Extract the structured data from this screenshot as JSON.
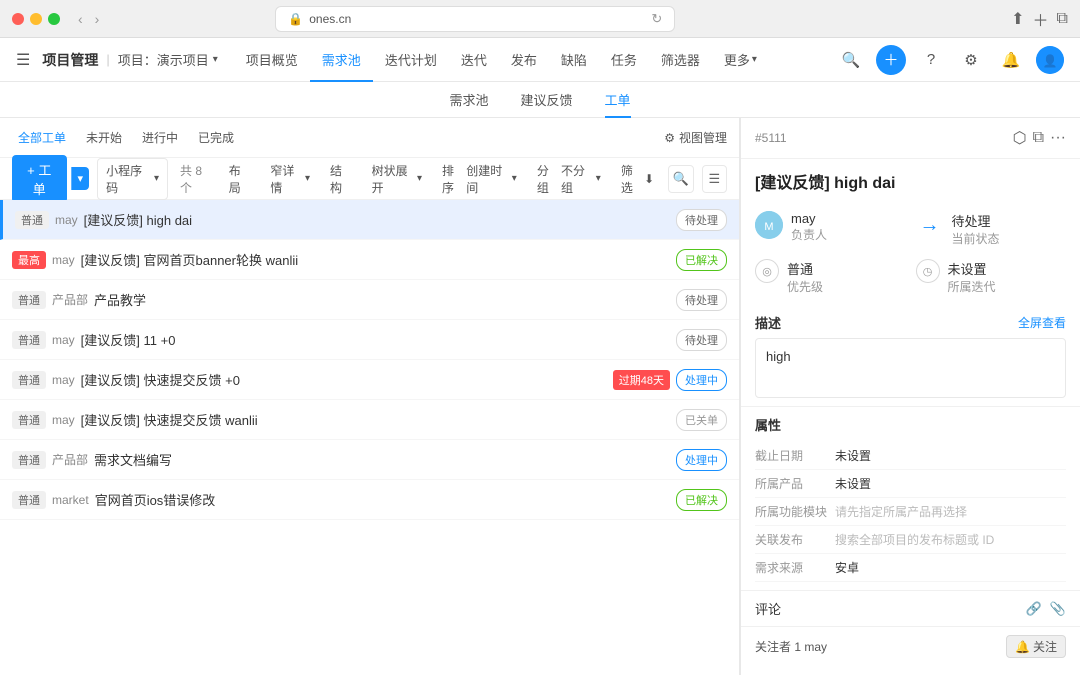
{
  "browser": {
    "url": "ones.cn",
    "lock_icon": "🔒"
  },
  "appbar": {
    "menu_icon": "☰",
    "title": "项目管理",
    "sep": "|",
    "project_label": "项目：演示项目",
    "nav_items": [
      {
        "label": "项目概览",
        "active": false
      },
      {
        "label": "需求池",
        "active": true
      },
      {
        "label": "迭代计划",
        "active": false
      },
      {
        "label": "迭代",
        "active": false
      },
      {
        "label": "发布",
        "active": false
      },
      {
        "label": "缺陷",
        "active": false
      },
      {
        "label": "任务",
        "active": false
      },
      {
        "label": "筛选器",
        "active": false
      },
      {
        "label": "更多",
        "active": false,
        "has_arrow": true
      }
    ]
  },
  "subnav": {
    "items": [
      {
        "label": "需求池",
        "active": false
      },
      {
        "label": "建议反馈",
        "active": false
      },
      {
        "label": "工单",
        "active": true
      }
    ]
  },
  "filter_tabs": [
    {
      "label": "全部工单",
      "active": true
    },
    {
      "label": "未开始",
      "active": false
    },
    {
      "label": "进行中",
      "active": false
    },
    {
      "label": "已完成",
      "active": false
    }
  ],
  "toolbar": {
    "add_label": "+ 工单",
    "filter_label": "小程序码",
    "count_label": "共 8 个",
    "layout_label": "布局",
    "detail_label": "窄详情",
    "structure_label": "结构",
    "tree_label": "树状展开",
    "sort_label": "排序",
    "sort_field": "创建时间",
    "group_label": "分组",
    "group_field": "不分组",
    "filter_right_label": "筛选",
    "view_mgmt_label": "视图管理"
  },
  "work_items": [
    {
      "priority": "普通",
      "priority_type": "normal",
      "creator": "may",
      "title": "[建议反馈] high dai",
      "status": "待处理",
      "status_type": "pending",
      "selected": true,
      "overdue": null
    },
    {
      "priority": "最高",
      "priority_type": "highest",
      "creator": "may",
      "title": "[建议反馈] 官网首页banner轮换 wanlii",
      "status": "已解决",
      "status_type": "resolved",
      "selected": false,
      "overdue": null
    },
    {
      "priority": "普通",
      "priority_type": "normal",
      "creator": "产品部",
      "title": "产品教学",
      "status": "待处理",
      "status_type": "pending",
      "selected": false,
      "overdue": null
    },
    {
      "priority": "普通",
      "priority_type": "normal",
      "creator": "may",
      "title": "[建议反馈] 11 +0",
      "status": "待处理",
      "status_type": "pending",
      "selected": false,
      "overdue": null
    },
    {
      "priority": "普通",
      "priority_type": "normal",
      "creator": "may",
      "title": "[建议反馈] 快速提交反馈 +0",
      "status": "处理中",
      "status_type": "processing",
      "selected": false,
      "overdue": "过期48天"
    },
    {
      "priority": "普通",
      "priority_type": "normal",
      "creator": "may",
      "title": "[建议反馈] 快速提交反馈 wanlii",
      "status": "已关单",
      "status_type": "closed",
      "selected": false,
      "overdue": null
    },
    {
      "priority": "普通",
      "priority_type": "normal",
      "creator": "产品部",
      "title": "需求文档编写",
      "status": "处理中",
      "status_type": "processing",
      "selected": false,
      "overdue": null
    },
    {
      "priority": "普通",
      "priority_type": "normal",
      "creator": "market",
      "title": "官网首页ios错误修改",
      "status": "已解决",
      "status_type": "resolved",
      "selected": false,
      "overdue": null
    }
  ],
  "detail": {
    "issue_id": "#5111",
    "title": "[建议反馈] high dai",
    "assignee_name": "may",
    "assignee_label": "负责人",
    "status_label": "待处理",
    "status_sub": "当前状态",
    "priority_label": "普通",
    "priority_sub": "优先级",
    "sprint_label": "未设置",
    "sprint_sub": "所属迭代",
    "desc_section": "描述",
    "desc_fullscreen": "全屏查看",
    "desc_content": "high",
    "attrs_title": "属性",
    "deadline_label": "截止日期",
    "deadline_value": "未设置",
    "product_label": "所属产品",
    "product_value": "未设置",
    "module_label": "所属功能模块",
    "module_value": "请先指定所属产品再选择",
    "release_label": "关联发布",
    "release_value": "搜索全部项目的发布标题或 ID",
    "channel_label": "需求来源",
    "channel_value": "安卓",
    "comment_label": "评论",
    "follower_label": "关注者 1 may",
    "follow_btn": "🔔 关注"
  }
}
